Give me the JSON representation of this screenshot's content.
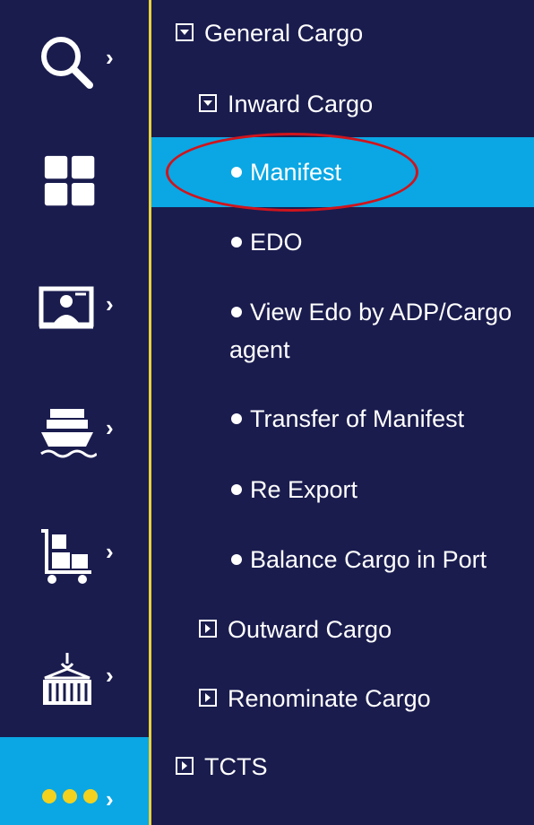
{
  "rail": {
    "items": [
      {
        "icon": "search-icon",
        "has_arrow": true
      },
      {
        "icon": "grid-icon",
        "has_arrow": false
      },
      {
        "icon": "presenter-icon",
        "has_arrow": true
      },
      {
        "icon": "ship-icon",
        "has_arrow": true
      },
      {
        "icon": "cargo-trolley-icon",
        "has_arrow": true
      },
      {
        "icon": "container-crane-icon",
        "has_arrow": true
      }
    ],
    "more": {
      "icon": "more-dots-icon",
      "arrow": "›"
    },
    "arrow_glyph": "›",
    "divider_color": "#e8d23c",
    "more_bg": "#0aa7e4",
    "dots_color": "#f2d21e"
  },
  "menu": {
    "general_cargo": {
      "label": "General Cargo",
      "state": "expanded"
    },
    "inward_cargo": {
      "label": "Inward Cargo",
      "state": "expanded"
    },
    "items": [
      {
        "label": "Manifest",
        "active": true
      },
      {
        "label": "EDO",
        "active": false
      },
      {
        "label": "View Edo by ADP/Cargo agent",
        "active": false
      },
      {
        "label": "Transfer of Manifest",
        "active": false
      },
      {
        "label": "Re Export",
        "active": false
      },
      {
        "label": "Balance Cargo in Port",
        "active": false
      }
    ],
    "outward_cargo": {
      "label": "Outward Cargo",
      "state": "collapsed"
    },
    "renominate_cargo": {
      "label": "Renominate Cargo",
      "state": "collapsed"
    },
    "tcts": {
      "label": "TCTS",
      "state": "collapsed"
    },
    "active_bg": "#0aa7e4",
    "annotation_color": "#d0141c"
  }
}
